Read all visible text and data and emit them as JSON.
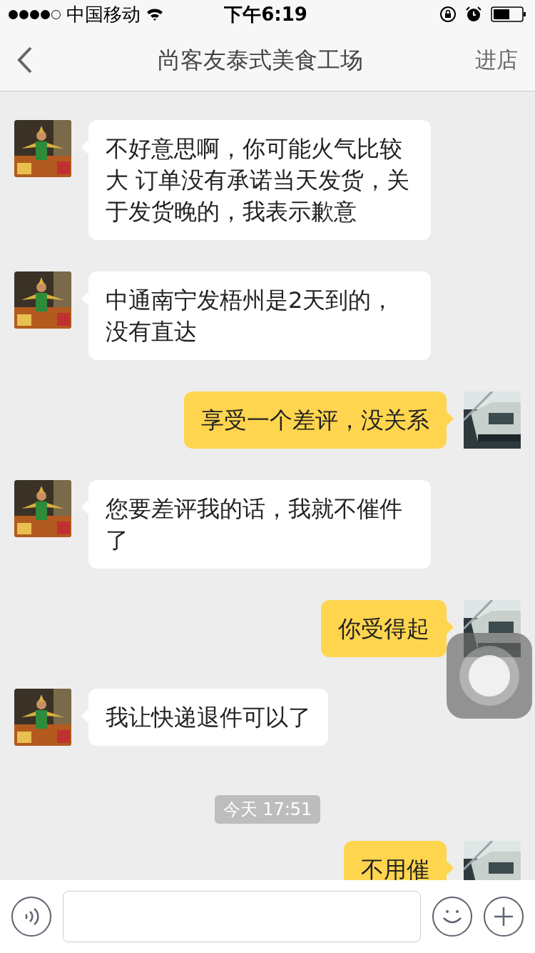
{
  "status_bar": {
    "carrier": "中国移动",
    "time": "下午6:19"
  },
  "nav": {
    "title": "尚客友泰式美食工场",
    "action": "进店"
  },
  "messages": [
    {
      "kind": "received",
      "text": "不好意思啊，你可能火气比较大 订单没有承诺当天发货，关于发货晚的，我表示歉意"
    },
    {
      "kind": "received",
      "text": "中通南宁发梧州是2天到的，没有直达"
    },
    {
      "kind": "sent",
      "text": "享受一个差评，没关系"
    },
    {
      "kind": "received",
      "text": "您要差评我的话，我就不催件了"
    },
    {
      "kind": "sent",
      "text": "你受得起"
    },
    {
      "kind": "received",
      "text": "我让快递退件可以了"
    },
    {
      "kind": "time",
      "text": "今天 17:51"
    },
    {
      "kind": "sent",
      "text": "不用催"
    }
  ]
}
